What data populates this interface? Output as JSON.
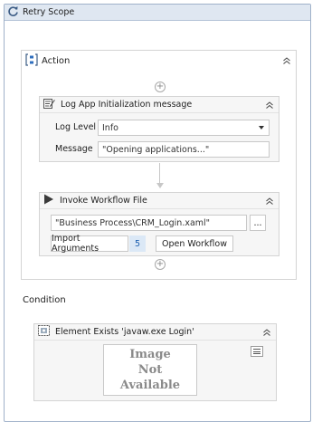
{
  "retry": {
    "title": "Retry Scope"
  },
  "action": {
    "title": "Action"
  },
  "log": {
    "title": "Log App Initialization message",
    "level_label": "Log Level",
    "level_value": "Info",
    "message_label": "Message",
    "message_value": "\"Opening applications...\""
  },
  "invoke": {
    "title": "Invoke Workflow File",
    "file_value": "\"Business Process\\CRM_Login.xaml\"",
    "browse_label": "...",
    "import_label": "Import Arguments",
    "import_count": "5",
    "open_label": "Open Workflow"
  },
  "condition": {
    "label": "Condition"
  },
  "element_exists": {
    "title": "Element Exists 'javaw.exe  Login'",
    "image_lines": [
      "Image",
      "Not",
      "Available"
    ]
  },
  "icons": [
    "retry-icon",
    "sequence-icon",
    "collapse-icon",
    "add-icon",
    "log-icon",
    "play-icon",
    "target-icon",
    "menu-icon"
  ]
}
